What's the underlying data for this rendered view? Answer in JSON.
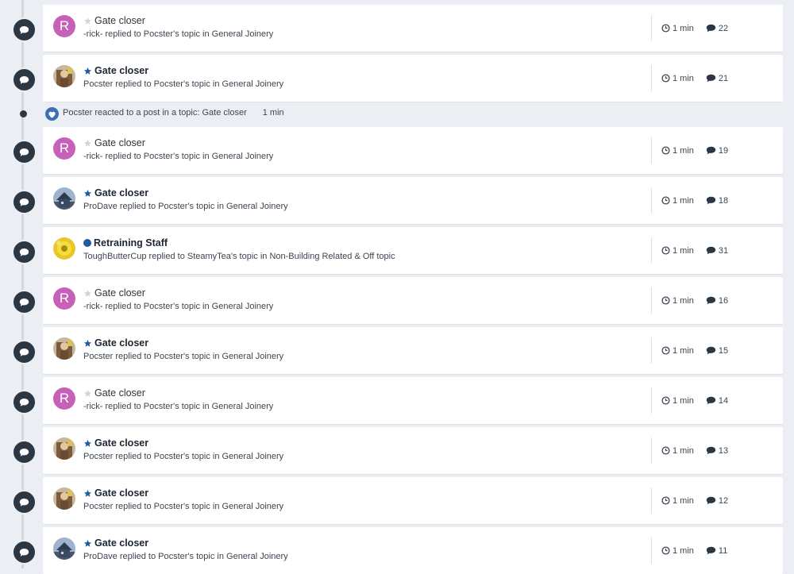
{
  "colors": {
    "accent": "#1d5ca3",
    "timeline_icon": "#2c3744",
    "avatar_letter_bg": "#c660b9"
  },
  "reaction": {
    "text": "Pocster reacted to a post in a topic: Gate closer",
    "time": "1 min",
    "icon": "heart-icon"
  },
  "items": [
    {
      "title": "Gate closer",
      "subtitle": "-rick- replied to Pocster's topic in General Joinery",
      "time": "1 min",
      "replies": "22",
      "unread": false,
      "marker": "star",
      "avatar": "R"
    },
    {
      "title": "Gate closer",
      "subtitle": "Pocster replied to Pocster's topic in General Joinery",
      "time": "1 min",
      "replies": "21",
      "unread": true,
      "marker": "star",
      "avatar": "pocster"
    },
    {
      "title": "Gate closer",
      "subtitle": "-rick- replied to Pocster's topic in General Joinery",
      "time": "1 min",
      "replies": "19",
      "unread": false,
      "marker": "star",
      "avatar": "R"
    },
    {
      "title": "Gate closer",
      "subtitle": "ProDave replied to Pocster's topic in General Joinery",
      "time": "1 min",
      "replies": "18",
      "unread": true,
      "marker": "star",
      "avatar": "prodave"
    },
    {
      "title": "Retraining Staff",
      "subtitle": "ToughButterCup replied to SteamyTea's topic in Non-Building Related & Off topic",
      "time": "1 min",
      "replies": "31",
      "unread": true,
      "marker": "dot",
      "avatar": "toughbuttercup"
    },
    {
      "title": "Gate closer",
      "subtitle": "-rick- replied to Pocster's topic in General Joinery",
      "time": "1 min",
      "replies": "16",
      "unread": false,
      "marker": "star",
      "avatar": "R"
    },
    {
      "title": "Gate closer",
      "subtitle": "Pocster replied to Pocster's topic in General Joinery",
      "time": "1 min",
      "replies": "15",
      "unread": true,
      "marker": "star",
      "avatar": "pocster"
    },
    {
      "title": "Gate closer",
      "subtitle": "-rick- replied to Pocster's topic in General Joinery",
      "time": "1 min",
      "replies": "14",
      "unread": false,
      "marker": "star",
      "avatar": "R"
    },
    {
      "title": "Gate closer",
      "subtitle": "Pocster replied to Pocster's topic in General Joinery",
      "time": "1 min",
      "replies": "13",
      "unread": true,
      "marker": "star",
      "avatar": "pocster"
    },
    {
      "title": "Gate closer",
      "subtitle": "Pocster replied to Pocster's topic in General Joinery",
      "time": "1 min",
      "replies": "12",
      "unread": true,
      "marker": "star",
      "avatar": "pocster"
    },
    {
      "title": "Gate closer",
      "subtitle": "ProDave replied to Pocster's topic in General Joinery",
      "time": "1 min",
      "replies": "11",
      "unread": true,
      "marker": "star",
      "avatar": "prodave"
    }
  ]
}
